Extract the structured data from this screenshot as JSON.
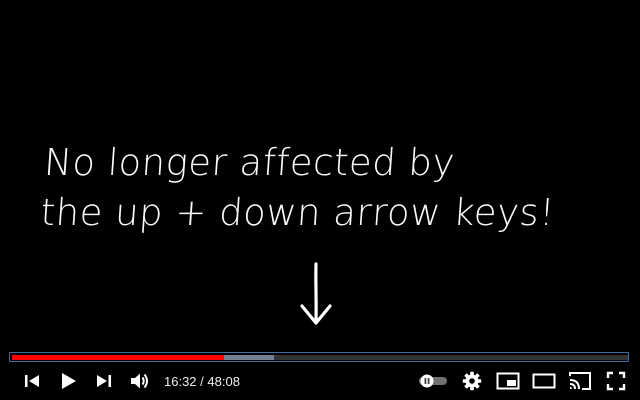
{
  "video": {
    "caption_lines": [
      "No longer affected by",
      "the up + down arrow keys!"
    ]
  },
  "progress": {
    "played_fraction": 0.3444,
    "loaded_fraction": 0.425,
    "played_color": "#ff0000"
  },
  "controls": {
    "previous_icon": "skip-previous-icon",
    "play_icon": "play-icon",
    "next_icon": "skip-next-icon",
    "volume_icon": "volume-icon",
    "current_time": "16:32",
    "time_separator": " / ",
    "duration": "48:08",
    "autoplay_icon": "autoplay-toggle-icon",
    "settings_icon": "gear-icon",
    "miniplayer_icon": "miniplayer-icon",
    "theater_icon": "theater-mode-icon",
    "cast_icon": "cast-icon",
    "fullscreen_icon": "fullscreen-icon"
  }
}
